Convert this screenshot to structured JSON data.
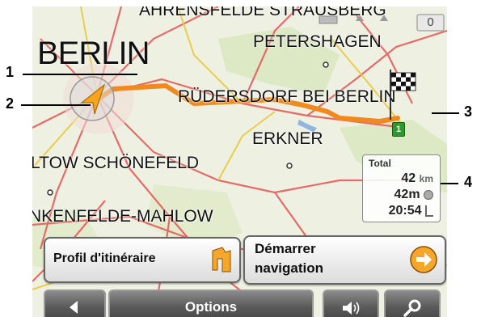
{
  "map": {
    "places": {
      "ahrensfelde": "AHRENSFELDE STRAUSBERG",
      "berlin": "BERLIN",
      "petershagen": "PETERSHAGEN",
      "rudersdorf": "RÜDERSDORF BEI BERLIN",
      "erkner": "ERKNER",
      "teltow": "LTOW SCHÖNEFELD",
      "blankenfelde": "NKENFELDE-MAHLOW"
    },
    "route_color": "#f08a1e",
    "start_marker": "1",
    "status_value": "0"
  },
  "callouts": [
    "1",
    "2",
    "3",
    "4"
  ],
  "total": {
    "label": "Total",
    "distance_value": "42",
    "distance_unit": "km",
    "duration": "42m",
    "arrival": "20:54"
  },
  "buttons": {
    "route_profile": "Profil d'itinéraire",
    "start_nav_line1": "Démarrer",
    "start_nav_line2": "navigation",
    "options": "Options"
  },
  "icons": [
    "position-arrow-icon",
    "finish-flag-icon",
    "clock-icon",
    "arrival-flag-icon",
    "route-profile-icon",
    "arrow-right-icon",
    "back-arrow-icon",
    "speaker-icon",
    "search-icon"
  ]
}
